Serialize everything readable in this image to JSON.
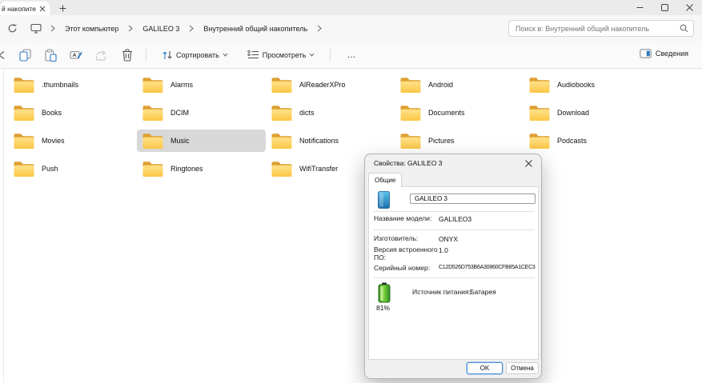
{
  "colors": {
    "accent": "#2f7ac2",
    "folder_front": "#ffd45e",
    "folder_back": "#dfa033",
    "selection": "#d8d8d8",
    "battery_green": "#3fae2a",
    "device_blue": "#2e9fd0",
    "chrome_gray": "#ebebeb"
  },
  "icons": {
    "tab-close-icon": "✕",
    "new-tab-icon": "+",
    "minimize-icon": "–",
    "maximize-icon": "□",
    "close-icon": "✕",
    "refresh-icon": "circular-arrow",
    "this-pc-icon": "monitor",
    "chevron-right-icon": "›",
    "search-icon": "magnifier",
    "cut-icon": "scissors",
    "copy-icon": "two-pages",
    "paste-icon": "clipboard",
    "rename-icon": "a-with-pencil",
    "share-icon": "share-arrow",
    "delete-icon": "trash-can",
    "sort-icon": "up-down-arrows",
    "view-icon": "list-lines",
    "chevron-down-icon": "⌄",
    "details-pane-icon": "split-panel",
    "folder-icon": "yellow-folder",
    "device-icon": "blue-phone",
    "battery-icon": "green-battery"
  },
  "window": {
    "tab_title": "й накопите"
  },
  "navbar": {
    "breadcrumb": [
      "Этот компьютер",
      "GALILEO 3",
      "Внутренний общий накопитель"
    ],
    "search_placeholder": "Поиск в: Внутренний общий накопитель"
  },
  "toolbar": {
    "sort_label": "Сортировать",
    "view_label": "Просмотреть",
    "more_label": "…",
    "details_label": "Сведения"
  },
  "files": {
    "selected_index": 11,
    "items": [
      ".thumbnails",
      "Alarms",
      "AlReaderXPro",
      "Android",
      "Audiobooks",
      "Books",
      "DCIM",
      "dicts",
      "Documents",
      "Download",
      "Movies",
      "Music",
      "Notifications",
      "Pictures",
      "Podcasts",
      "Push",
      "Ringtones",
      "WifiTransfer"
    ]
  },
  "dialog": {
    "title": "Свойства: GALILEO 3",
    "tab_label": "Общие",
    "device_name": "GALILEO 3",
    "fields": [
      {
        "label": "Название модели:",
        "value": "GALILEO3"
      },
      {
        "label": "Изготовитель:",
        "value": "ONYX"
      },
      {
        "label": "Версия встроенного ПО:",
        "value": "1.0"
      },
      {
        "label": "Серийный номер:",
        "value": "C12D526D753B6A30860CFB65A1CEC3"
      }
    ],
    "power": {
      "label": "Источник питания:",
      "value": "Батарея",
      "percent": "81%"
    },
    "ok_label": "OK",
    "cancel_label": "Отмена"
  }
}
